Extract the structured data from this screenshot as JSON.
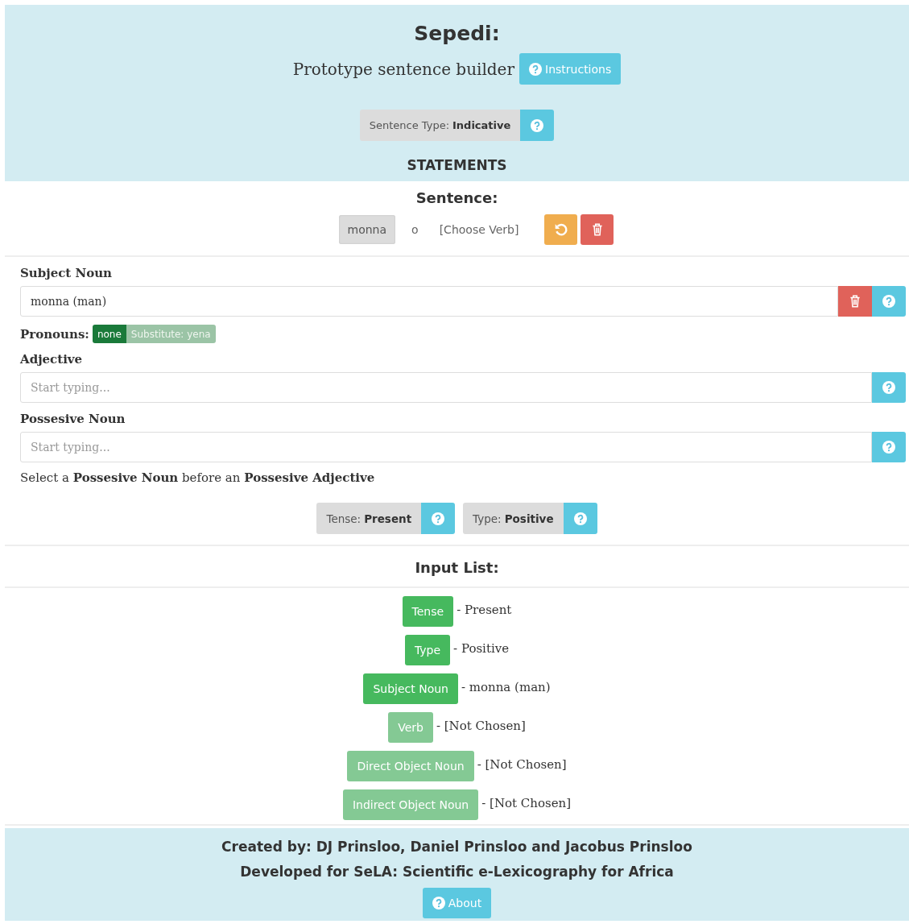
{
  "header": {
    "title": "Sepedi:",
    "subtitle": "Prototype sentence builder",
    "instructions_button": "Instructions",
    "sentence_type": {
      "label": "Sentence Type:",
      "value": "Indicative"
    },
    "section": "STATEMENTS"
  },
  "sentence": {
    "heading": "Sentence:",
    "words": [
      {
        "text": "monna",
        "kind": "chip"
      },
      {
        "text": "o",
        "kind": "plain"
      },
      {
        "text": "[Choose Verb]",
        "kind": "plain"
      }
    ]
  },
  "fields": [
    {
      "label": "Subject Noun",
      "value": "monna (man)",
      "deletable": true
    },
    {
      "label": "Adjective",
      "placeholder": "Start typing...",
      "deletable": false
    },
    {
      "label": "Possesive Noun",
      "placeholder": "Start typing...",
      "deletable": false
    }
  ],
  "pronouns": {
    "label": "Pronouns:",
    "options": [
      {
        "text": "none",
        "selected": true
      },
      {
        "text": "Substitute: yena",
        "selected": false
      }
    ]
  },
  "note": "Select a **Possesive Noun** before an **Possesive Adjective**",
  "selectors": [
    {
      "label": "Tense:",
      "value": "Present"
    },
    {
      "label": "Type:",
      "value": "Positive"
    }
  ],
  "input_list": {
    "heading": "Input List:",
    "items": [
      {
        "name": "Tense",
        "value": "- Present",
        "chosen": true
      },
      {
        "name": "Type",
        "value": "- Positive",
        "chosen": true
      },
      {
        "name": "Subject Noun",
        "value": "- monna (man)",
        "chosen": true
      },
      {
        "name": "Verb",
        "value": "- [Not Chosen]",
        "chosen": false
      },
      {
        "name": "Direct Object Noun",
        "value": "- [Not Chosen]",
        "chosen": false
      },
      {
        "name": "Indirect Object Noun",
        "value": "- [Not Chosen]",
        "chosen": false
      }
    ]
  },
  "footer": {
    "lines": [
      "Created by: DJ Prinsloo, Daniel Prinsloo and Jacobus Prinsloo",
      "Developed for SeLA: Scientific e-Lexicography for Africa"
    ],
    "about_button": "About"
  }
}
